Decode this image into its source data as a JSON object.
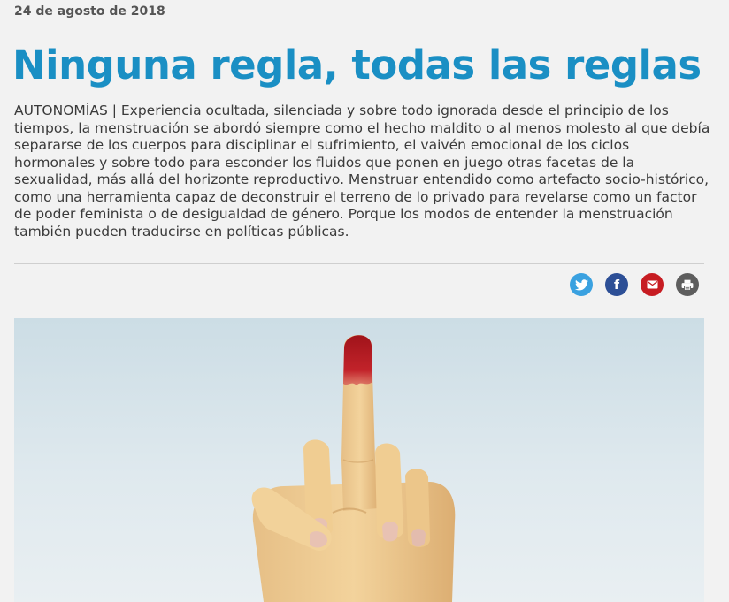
{
  "article": {
    "date": "24 de agosto de 2018",
    "title": "Ninguna regla, todas las reglas",
    "lede": "AUTONOMÍAS | Experiencia ocultada, silenciada y sobre todo ignorada desde el principio de los tiempos, la menstruación se abordó siempre como el hecho maldito o al menos molesto al que debía separarse de los cuerpos para disciplinar el sufrimiento, el vaivén emocional de los ciclos hormonales y sobre todo para esconder los fluidos que ponen en juego otras facetas de la sexualidad, más allá del horizonte reproductivo. Menstruar entendido como artefacto socio-histórico, como una herramienta capaz de deconstruir el terreno de lo privado para revelarse como un factor de poder feminista o de desigualdad de género. Porque los modos de entender la menstruación también pueden traducirse en políticas públicas."
  },
  "share": {
    "buttons": [
      {
        "network": "twitter",
        "icon": "twitter-bird-icon",
        "color": "#3aa1e0"
      },
      {
        "network": "facebook",
        "icon": "facebook-f-icon",
        "glyph": "f",
        "color": "#2d4f96"
      },
      {
        "network": "email",
        "icon": "envelope-icon",
        "color": "#c71c22"
      },
      {
        "network": "print",
        "icon": "printer-icon",
        "color": "#5e5e5e"
      }
    ]
  },
  "theme": {
    "title_color": "#1a8fc4",
    "text_color": "#3a3a3a",
    "date_color": "#555555",
    "background": "#f2f2f2"
  }
}
